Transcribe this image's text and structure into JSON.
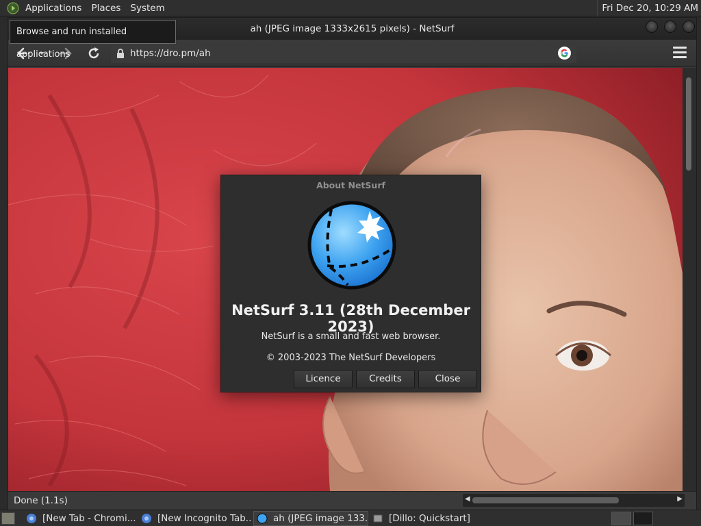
{
  "top_panel": {
    "menus": [
      "Applications",
      "Places",
      "System"
    ],
    "clock": "Fri Dec 20, 10:29 AM"
  },
  "tooltip": "Browse and run installed applications",
  "browser": {
    "title": "ah (JPEG image 1333x2615 pixels) - NetSurf",
    "url": "https://dro.pm/ah",
    "status": "Done (1.1s)"
  },
  "about_dialog": {
    "title": "About NetSurf",
    "app_name": "NetSurf 3.11 (28th December 2023)",
    "comment": "NetSurf is a small and fast web browser.",
    "copyright": "© 2003-2023 The NetSurf Developers",
    "buttons": [
      "Licence",
      "Credits",
      "Close"
    ]
  },
  "taskbar": {
    "tasks": [
      {
        "label": "[New Tab - Chromi...",
        "icon": "chromium-icon",
        "active": false
      },
      {
        "label": "[New Incognito Tab...",
        "icon": "chromium-icon",
        "active": false
      },
      {
        "label": "ah (JPEG image 133...",
        "icon": "netsurf-icon",
        "active": true
      },
      {
        "label": "[Dillo: Quickstart]",
        "icon": "dillo-icon",
        "active": false
      }
    ]
  },
  "colors": {
    "panel": "#2f2f2f",
    "image_background": "#c4353c",
    "netsurf_blue": "#2b8fe8"
  }
}
